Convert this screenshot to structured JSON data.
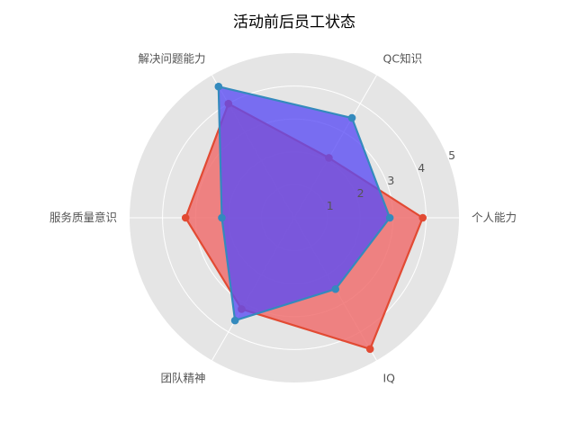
{
  "chart_data": {
    "type": "radar",
    "title": "活动前后员工状态",
    "axes": [
      "个人能力",
      "QC知识",
      "解决问题能力",
      "服务质量意识",
      "团队精神",
      "IQ"
    ],
    "rlim": [
      0,
      5
    ],
    "radial_ticks": [
      "1",
      "2",
      "3",
      "4",
      "5"
    ],
    "grid": true,
    "legend": false,
    "series": [
      {
        "values": [
          3.9,
          2.1,
          4.0,
          3.3,
          3.2,
          4.6
        ],
        "color": "#e24a33",
        "fill": "#f07070",
        "fill_opacity": 0.85
      },
      {
        "values": [
          2.9,
          3.5,
          4.6,
          2.2,
          3.6,
          2.5
        ],
        "color": "#348abd",
        "fill": "#5a4cf5",
        "fill_opacity": 0.78
      }
    ],
    "background_color": "#e5e5e5",
    "grid_color": "#ffffff"
  }
}
